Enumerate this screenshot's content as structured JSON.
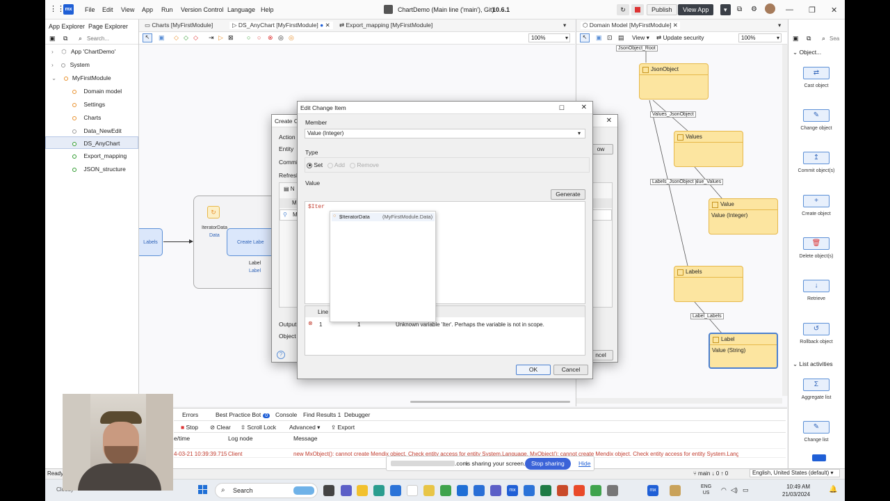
{
  "titlebar": {
    "menus": [
      "File",
      "Edit",
      "View",
      "App",
      "Run",
      "Version Control",
      "Language",
      "Help"
    ],
    "title": "ChartDemo (Main line ('main'), Git)",
    "version": "10.6.1",
    "publish": "Publish",
    "view_app": "View App",
    "logo": "mx"
  },
  "left_panel": {
    "tabs": [
      "App Explorer",
      "Page Explorer"
    ],
    "search_placeholder": "Search...",
    "items": [
      {
        "label": "App 'ChartDemo'"
      },
      {
        "label": "System"
      },
      {
        "label": "MyFirstModule"
      },
      {
        "label": "Domain model"
      },
      {
        "label": "Settings"
      },
      {
        "label": "Charts"
      },
      {
        "label": "Data_NewEdit"
      },
      {
        "label": "DS_AnyChart"
      },
      {
        "label": "Export_mapping"
      },
      {
        "label": "JSON_structure"
      }
    ]
  },
  "doc_tabs": [
    "Charts [MyFirstModule]",
    "DS_AnyChart [MyFirstModule]",
    "Export_mapping [MyFirstModule]"
  ],
  "zoom_center": "100%",
  "microflow": {
    "node_labels": "Labels",
    "iterator_label": "IteratorData",
    "iterator_sub": "Data",
    "create_label": "Create Labe",
    "label_a": "Label",
    "label_b": "Label"
  },
  "domain_model": {
    "tab": "Domain Model [MyFirstModule]",
    "view": "View",
    "update_security": "Update security",
    "zoom": "100%",
    "entities": [
      {
        "name": "JsonObject",
        "attr": ""
      },
      {
        "name": "Values",
        "attr": ""
      },
      {
        "name": "Value",
        "attr": "Value (Integer)"
      },
      {
        "name": "Labels",
        "attr": ""
      },
      {
        "name": "Label",
        "attr": "Value (String)"
      }
    ],
    "assoc_labels": [
      "JsonObject_Root",
      "Values_JsonObject",
      "Value_Values",
      "Labels_JsonObject",
      "Label_Labels"
    ]
  },
  "toolbox": {
    "header": "Object...",
    "list_header": "List activities",
    "search_placeholder": "Sea",
    "tools": [
      "Cast object",
      "Change object",
      "Commit object(s)",
      "Create object",
      "Delete object(s)",
      "Retrieve",
      "Rollback object",
      "Aggregate list",
      "Change list"
    ]
  },
  "create_dialog": {
    "title": "Create O",
    "rows": [
      "Action",
      "Entity",
      "Commi",
      "Refresh",
      "Output",
      "Object"
    ],
    "new_label": "N",
    "col_header": "M",
    "row_label": "M",
    "partial_btn": "ow",
    "cancel_partial": "ncel"
  },
  "edit_dialog": {
    "title": "Edit Change Item",
    "member_label": "Member",
    "member_value": "Value (Integer)",
    "type_label": "Type",
    "type_options": [
      "Set",
      "Add",
      "Remove"
    ],
    "value_label": "Value",
    "generate": "Generate",
    "expression": "$Iter",
    "suggestion_name": "$IteratorData",
    "suggestion_type": "(MyFirstModule.Data)",
    "error_col": "Line",
    "error_line": "1",
    "error_col_num": "1",
    "error_msg": "Unknown variable 'Iter'. Perhaps the variable is not in scope.",
    "ok": "OK",
    "cancel": "Cancel"
  },
  "bottom_panel": {
    "tabs": [
      "Errors",
      "Best Practice Bot",
      "Console",
      "Find Results 1",
      "Debugger"
    ],
    "best_practice_count": "0",
    "actions": [
      "Stop",
      "Clear",
      "Scroll Lock",
      "Advanced",
      "Export"
    ],
    "columns": [
      "e/time",
      "Log node",
      "Message"
    ],
    "row": {
      "time": "4-03-21 10:39:39.715",
      "node": "Client",
      "message": "new MxObject(): cannot create Mendix object. Check entity access for entity System.Language. MxObject(): cannot create Mendix object. Check entity access for entity System.Language (...)"
    }
  },
  "status": {
    "ready": "Ready",
    "branch": "main",
    "down": "0",
    "up": "0",
    "lang": "English, United States (default)"
  },
  "share_banner": {
    "text": "is sharing your screen.",
    "domain_suffix": ".com",
    "stop": "Stop sharing",
    "hide": "Hide"
  },
  "taskbar": {
    "search": "Search",
    "weather": "Cloudy",
    "lang1": "ENG",
    "lang2": "US",
    "time": "10:49 AM",
    "date": "21/03/2024"
  }
}
